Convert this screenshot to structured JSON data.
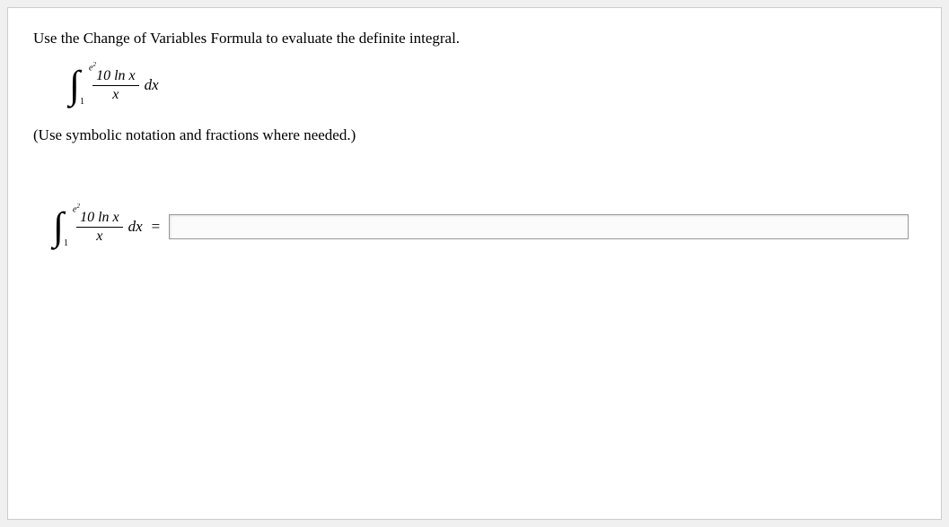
{
  "question": {
    "instruction": "Use the Change of Variables Formula to evaluate the definite integral.",
    "hint": "(Use symbolic notation and fractions where needed.)",
    "integral": {
      "upper_limit_base": "e",
      "upper_limit_exp": "2",
      "lower_limit": "1",
      "numerator": "10 ln x",
      "denominator": "x",
      "differential": "dx"
    },
    "equals": "=",
    "answer_value": ""
  }
}
